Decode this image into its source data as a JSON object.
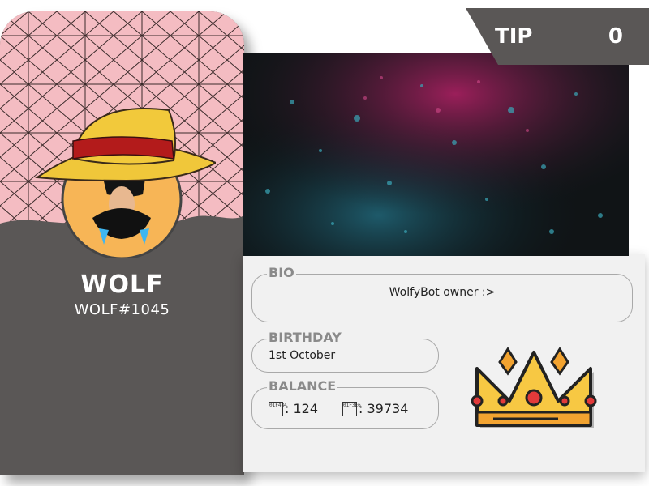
{
  "profile": {
    "username": "WOLF",
    "tag": "WOLF#1045",
    "avatar_icon": "straw-hat-avatar-icon"
  },
  "tip": {
    "label": "TIP",
    "value": "0"
  },
  "bio": {
    "legend": "BIO",
    "text": "WolfyBot owner :>"
  },
  "birthday": {
    "legend": "BIRTHDAY",
    "text": "1st October"
  },
  "balance": {
    "legend": "BALANCE",
    "items": [
      {
        "icon": "missing-glyph-icon",
        "glyph": "01F4B4",
        "text": ": 124"
      },
      {
        "icon": "missing-glyph-icon",
        "glyph": "01F3E6",
        "text": ": 39734"
      }
    ]
  },
  "badge": {
    "icon": "crown-icon"
  },
  "colors": {
    "card": "#5a5756",
    "pattern_bg": "#f4bcc2",
    "pattern_line": "#3a2a2a",
    "tip_tab": "#5a5756",
    "panel": "#f1f1f1",
    "crown_gold": "#f7c843",
    "crown_red": "#e23a3a"
  }
}
